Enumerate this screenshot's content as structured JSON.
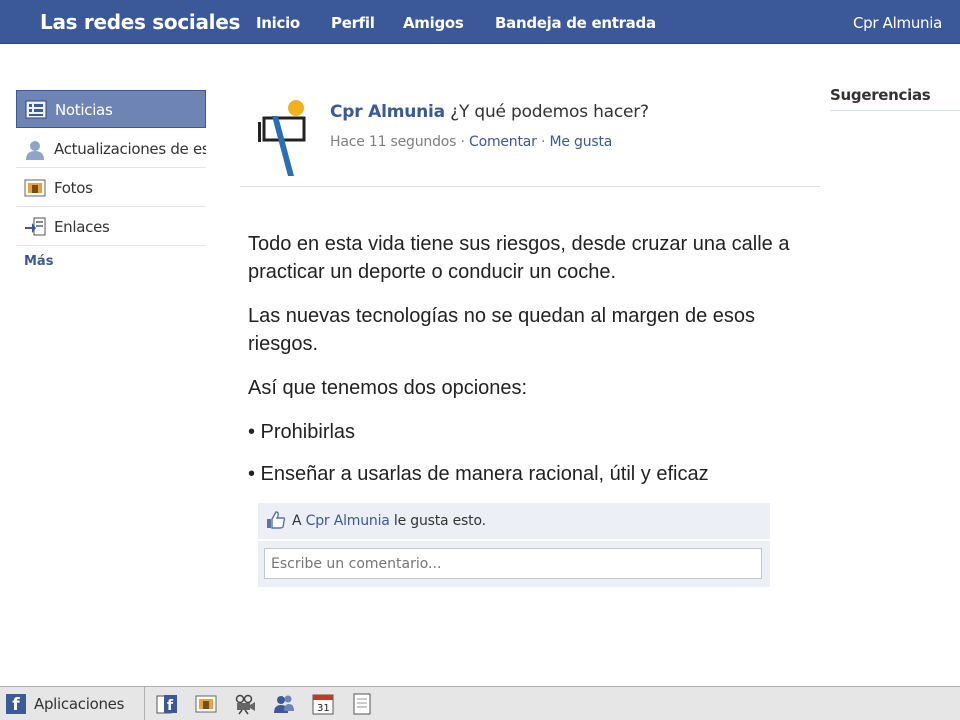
{
  "topbar": {
    "brand": "Las redes sociales",
    "nav": [
      "Inicio",
      "Perfil",
      "Amigos",
      "Bandeja de entrada"
    ],
    "user": "Cpr Almunia"
  },
  "sidebar": {
    "items": [
      {
        "label": "Noticias",
        "icon": "news-feed-icon"
      },
      {
        "label": "Actualizaciones de estado",
        "icon": "user-icon"
      },
      {
        "label": "Fotos",
        "icon": "photos-icon"
      },
      {
        "label": "Enlaces",
        "icon": "links-icon"
      }
    ],
    "more": "Más"
  },
  "post": {
    "author": "Cpr Almunia",
    "message": "¿Y qué podemos hacer?",
    "time": "Hace 11 segundos",
    "separator": "·",
    "comment": "Comentar",
    "like": "Me gusta"
  },
  "body": {
    "p1": "Todo en esta vida tiene sus riesgos, desde cruzar una calle a practicar un deporte o conducir un coche.",
    "p2": "Las nuevas tecnologías no se quedan al margen de esos riesgos.",
    "p3": "Así que tenemos dos opciones:",
    "b1": "• Prohibirlas",
    "b2": "• Enseñar a usarlas de manera racional, útil y eficaz"
  },
  "likes": {
    "prefix": "A",
    "who": "Cpr Almunia",
    "suffix": "le gusta esto.",
    "comment_placeholder": "Escribe un comentario..."
  },
  "right": {
    "title": "Sugerencias"
  },
  "bottombar": {
    "apps_label": "Aplicaciones",
    "calendar_day": "31",
    "tray_icons": [
      "facebook-pages-icon",
      "photos-icon",
      "video-icon",
      "friends-icon",
      "calendar-icon",
      "notes-icon"
    ]
  },
  "colors": {
    "brand": "#3b5998",
    "active": "#6d84b4",
    "like_bg": "#eceff5"
  }
}
